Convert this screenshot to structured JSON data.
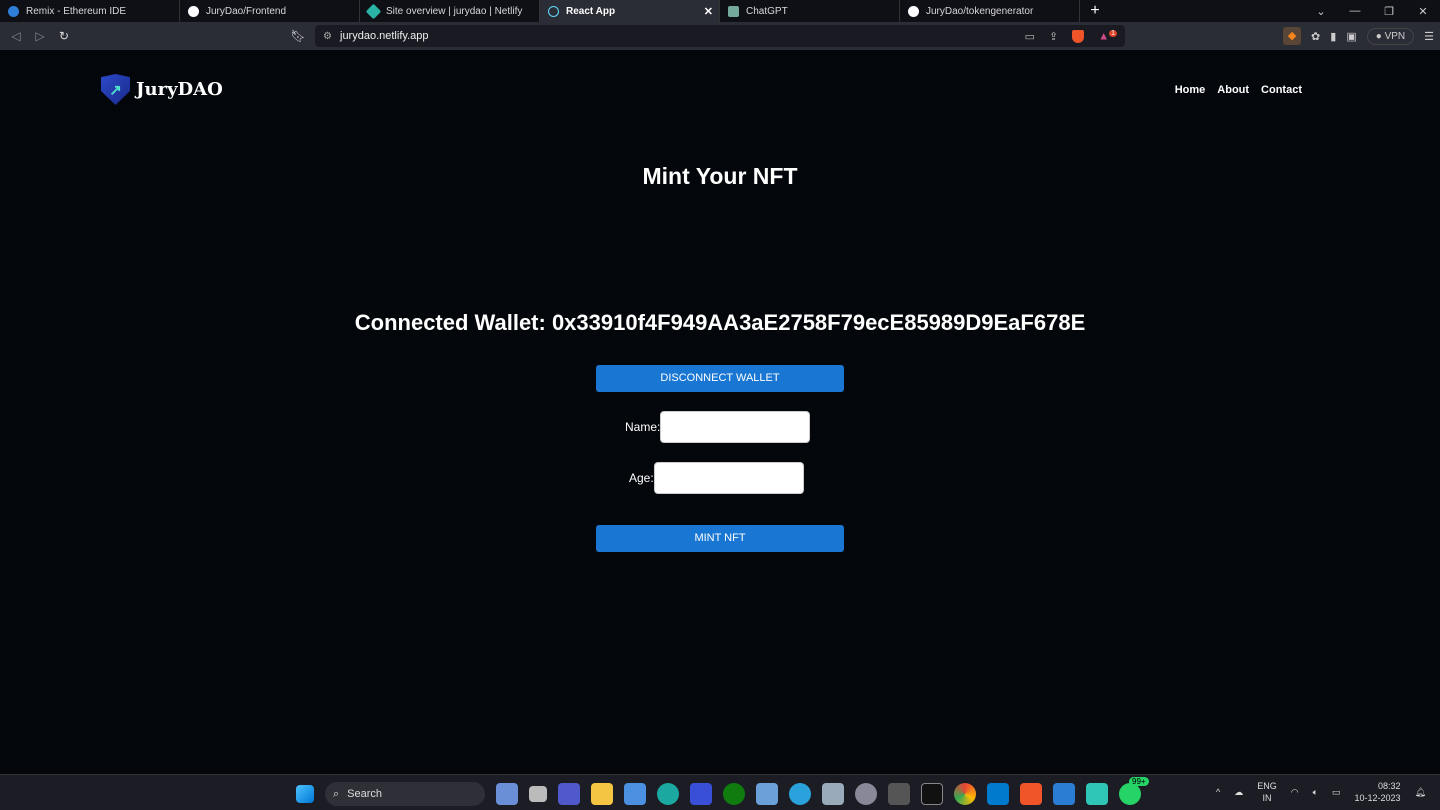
{
  "browser": {
    "tabs": [
      {
        "title": "Remix - Ethereum IDE",
        "color": "#2f7fd8",
        "active": false
      },
      {
        "title": "JuryDao/Frontend",
        "color": "#ffffff",
        "active": false
      },
      {
        "title": "Site overview | jurydao | Netlify",
        "color": "#2ab3a6",
        "active": false
      },
      {
        "title": "React App",
        "color": "#61dafb",
        "active": true
      },
      {
        "title": "ChatGPT",
        "color": "#74aa9c",
        "active": false
      },
      {
        "title": "JuryDao/tokengenerator",
        "color": "#ffffff",
        "active": false
      }
    ],
    "new_tab": "+",
    "url": "jurydao.netlify.app",
    "vpn": "VPN",
    "notification_count": "1"
  },
  "site": {
    "logo": "JuryDAO",
    "nav": [
      "Home",
      "About",
      "Contact"
    ],
    "title": "Mint Your NFT",
    "wallet_label": "Connected Wallet: 0x33910f4F949AA3aE2758F79ecE85989D9EaF678E",
    "disconnect_label": "DISCONNECT WALLET",
    "name_label": "Name:",
    "name_value": "",
    "age_label": "Age:",
    "age_value": "",
    "mint_label": "MINT NFT",
    "accent": "#1976d2"
  },
  "taskbar": {
    "search": "Search",
    "lang": "ENG",
    "region": "IN",
    "time": "08:32",
    "date": "10-12-2023",
    "whatsapp_badge": "99+"
  }
}
